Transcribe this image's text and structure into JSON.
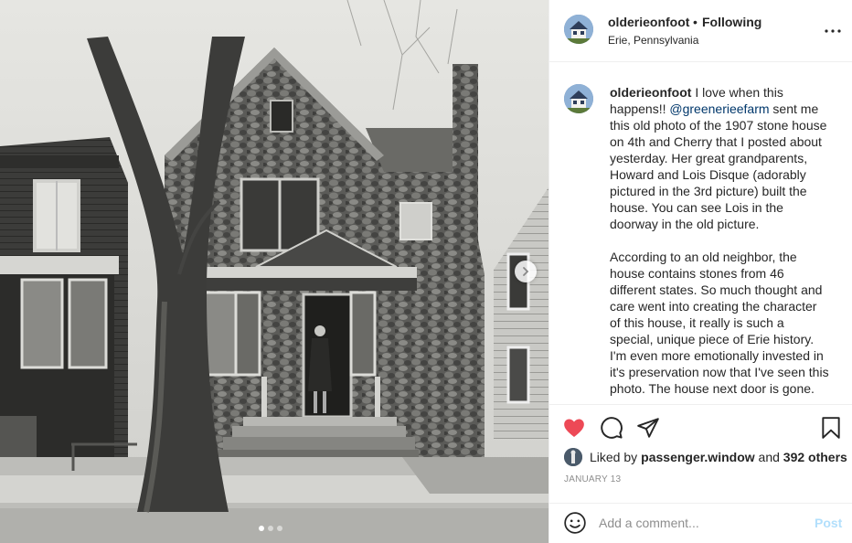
{
  "post": {
    "username": "olderieonfoot",
    "separator": "•",
    "follow_status": "Following",
    "location": "Erie, Pennsylvania"
  },
  "caption": {
    "username": "olderieonfoot",
    "part1": " I love when this happens!! ",
    "mention": "@greenerieefarm",
    "part2": " sent me this old photo of the 1907 stone house on 4th and Cherry that I posted about yesterday. Her great grandparents, Howard and Lois Disque (adorably pictured in the 3rd picture) built the house. You can see Lois in the doorway in the old picture.\n\nAccording to an old neighbor, the house contains stones from 46 different states. So much thought and care went into creating the character of this house, it really is such a special, unique piece of Erie history. I'm even more emotionally invested in it's preservation now that I've seen this photo. The house next door is gone."
  },
  "likes": {
    "prefix": "Liked by ",
    "user": "passenger.window",
    "middle": " and ",
    "count": "392 others"
  },
  "date": "JANUARY 13",
  "comment": {
    "placeholder": "Add a comment...",
    "post_label": "Post"
  },
  "carousel": {
    "slides": 3,
    "active": 1
  },
  "icons": {
    "like": "heart-filled-icon",
    "comment": "comment-bubble-icon",
    "share": "paper-plane-icon",
    "save": "bookmark-icon",
    "more": "more-horizontal-icon",
    "next": "chevron-right-icon",
    "emoji": "smiley-icon"
  },
  "colors": {
    "like_red": "#ed4956",
    "link_blue": "#00376b",
    "post_disabled": "#b2dffc",
    "secondary_text": "#8e8e8e"
  }
}
